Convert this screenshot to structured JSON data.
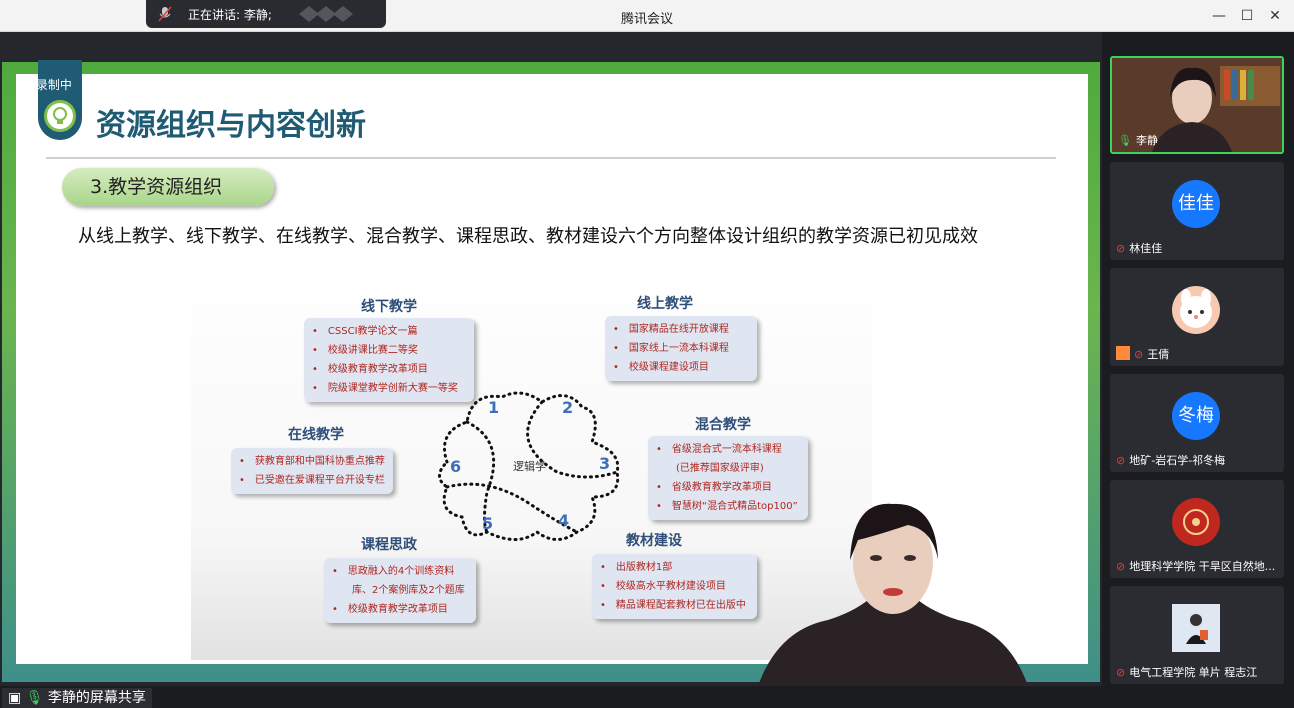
{
  "window": {
    "title": "腾讯会议",
    "minimize": "—",
    "maximize": "☐",
    "close": "✕"
  },
  "speaking": {
    "text": "正在讲话: 李静;"
  },
  "recording": {
    "label": "录制中"
  },
  "slide": {
    "title": "资源组织与内容创新",
    "section_pill": "3.教学资源组织",
    "subtitle": "从线上教学、线下教学、在线教学、混合教学、课程思政、教材建设六个方向整体设计组织的教学资源已初见成效",
    "center_label": "逻辑学",
    "numbers": [
      "1",
      "2",
      "3",
      "4",
      "5",
      "6"
    ],
    "sections": {
      "offline": {
        "title": "线下教学",
        "items": [
          "CSSCI教学论文一篇",
          "校级讲课比赛二等奖",
          "校级教育教学改革项目",
          "院级课堂教学创新大赛一等奖"
        ]
      },
      "online": {
        "title": "线上教学",
        "items": [
          "国家精品在线开放课程",
          "国家线上一流本科课程",
          "校级课程建设项目"
        ]
      },
      "internet": {
        "title": "在线教学",
        "items": [
          "获教育部和中国科协重点推荐",
          "已受邀在爱课程平台开设专栏"
        ]
      },
      "blended": {
        "title": "混合教学",
        "items": [
          "省级混合式一流本科课程",
          "(已推荐国家级评审)",
          "省级教育教学改革项目",
          "智慧树“混合式精品top100”"
        ]
      },
      "ideology": {
        "title": "课程思政",
        "items": [
          "思政融入的4个训练资料",
          "库、2个案例库及2个题库",
          "校级教育教学改革项目"
        ]
      },
      "textbook": {
        "title": "教材建设",
        "items": [
          "出版教材1部",
          "校级高水平教材建设项目",
          "精品课程配套教材已在出版中"
        ]
      }
    }
  },
  "participants": [
    {
      "name": "李静",
      "mic": "on",
      "avatar_text": "",
      "avatar_color": "#5a3a2a"
    },
    {
      "name": "林佳佳",
      "mic": "off",
      "avatar_text": "佳佳",
      "avatar_color": "#1677ff"
    },
    {
      "name": "王倩",
      "mic": "off",
      "avatar_text": "",
      "avatar_color": "#f6c9b0"
    },
    {
      "name": "地矿-岩石学-祁冬梅",
      "mic": "off",
      "avatar_text": "冬梅",
      "avatar_color": "#1677ff"
    },
    {
      "name": "地理科学学院 干旱区自然地...",
      "mic": "off",
      "avatar_text": "",
      "avatar_color": "#c0281f"
    },
    {
      "name": "电气工程学院 单片 程志江",
      "mic": "off",
      "avatar_text": "",
      "avatar_color": "#e8eef5"
    }
  ],
  "bottom": {
    "share_label": "李静的屏幕共享"
  }
}
